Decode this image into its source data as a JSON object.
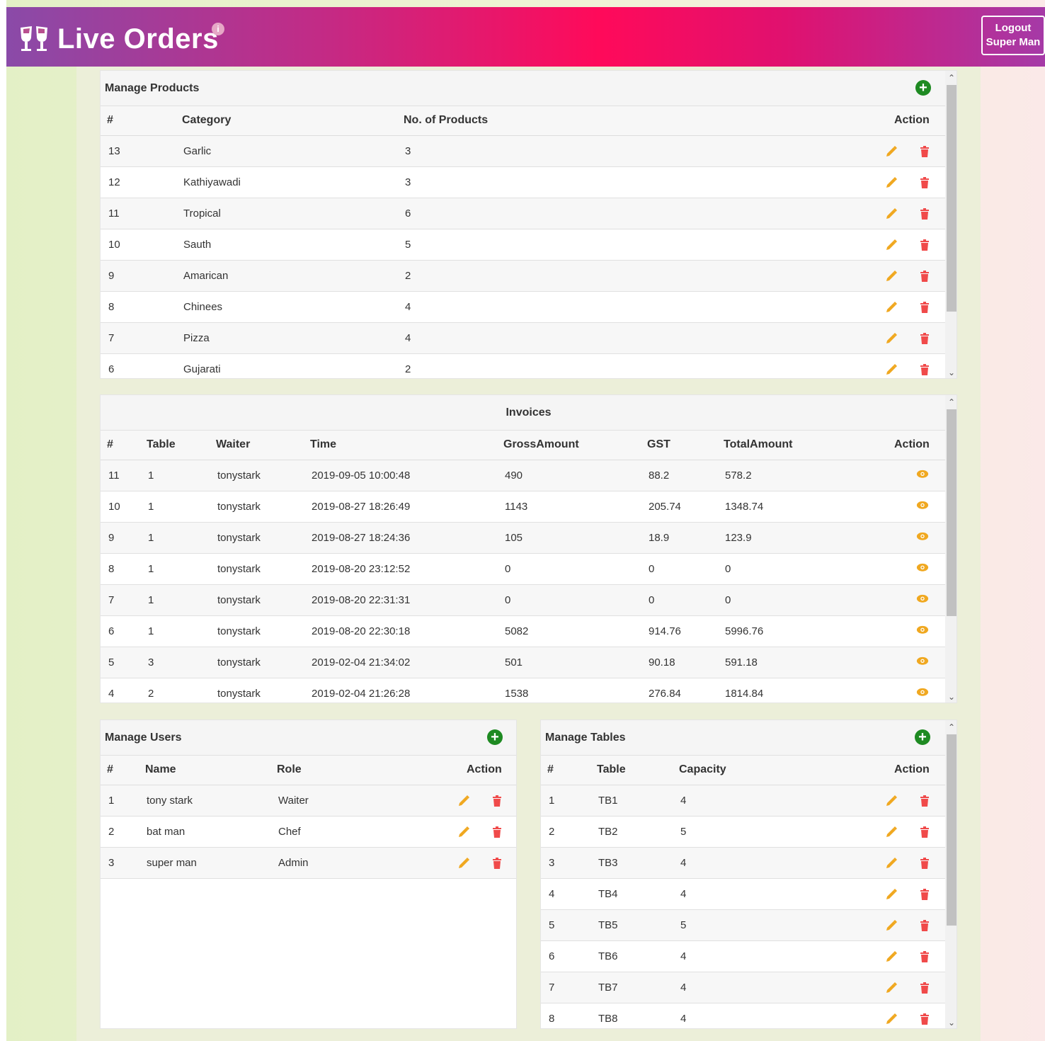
{
  "header": {
    "title": "Live Orders",
    "info_glyph": "i",
    "logout_label": "Logout",
    "user_name": "Super Man"
  },
  "products": {
    "title": "Manage Products",
    "columns": [
      "#",
      "Category",
      "No. of Products",
      "Action"
    ],
    "rows": [
      [
        "13",
        "Garlic",
        "3"
      ],
      [
        "12",
        "Kathiyawadi",
        "3"
      ],
      [
        "11",
        "Tropical",
        "6"
      ],
      [
        "10",
        "Sauth",
        "5"
      ],
      [
        "9",
        "Amarican",
        "2"
      ],
      [
        "8",
        "Chinees",
        "4"
      ],
      [
        "7",
        "Pizza",
        "4"
      ],
      [
        "6",
        "Gujarati",
        "2"
      ]
    ]
  },
  "invoices": {
    "title": "Invoices",
    "columns": [
      "#",
      "Table",
      "Waiter",
      "Time",
      "GrossAmount",
      "GST",
      "TotalAmount",
      "Action"
    ],
    "rows": [
      [
        "11",
        "1",
        "tonystark",
        "2019-09-05 10:00:48",
        "490",
        "88.2",
        "578.2"
      ],
      [
        "10",
        "1",
        "tonystark",
        "2019-08-27 18:26:49",
        "1143",
        "205.74",
        "1348.74"
      ],
      [
        "9",
        "1",
        "tonystark",
        "2019-08-27 18:24:36",
        "105",
        "18.9",
        "123.9"
      ],
      [
        "8",
        "1",
        "tonystark",
        "2019-08-20 23:12:52",
        "0",
        "0",
        "0"
      ],
      [
        "7",
        "1",
        "tonystark",
        "2019-08-20 22:31:31",
        "0",
        "0",
        "0"
      ],
      [
        "6",
        "1",
        "tonystark",
        "2019-08-20 22:30:18",
        "5082",
        "914.76",
        "5996.76"
      ],
      [
        "5",
        "3",
        "tonystark",
        "2019-02-04 21:34:02",
        "501",
        "90.18",
        "591.18"
      ],
      [
        "4",
        "2",
        "tonystark",
        "2019-02-04 21:26:28",
        "1538",
        "276.84",
        "1814.84"
      ]
    ]
  },
  "users": {
    "title": "Manage Users",
    "columns": [
      "#",
      "Name",
      "Role",
      "Action"
    ],
    "rows": [
      [
        "1",
        "tony stark",
        "Waiter"
      ],
      [
        "2",
        "bat man",
        "Chef"
      ],
      [
        "3",
        "super man",
        "Admin"
      ]
    ]
  },
  "tables": {
    "title": "Manage Tables",
    "columns": [
      "#",
      "Table",
      "Capacity",
      "Action"
    ],
    "rows": [
      [
        "1",
        "TB1",
        "4"
      ],
      [
        "2",
        "TB2",
        "5"
      ],
      [
        "3",
        "TB3",
        "4"
      ],
      [
        "4",
        "TB4",
        "4"
      ],
      [
        "5",
        "TB5",
        "5"
      ],
      [
        "6",
        "TB6",
        "4"
      ],
      [
        "7",
        "TB7",
        "4"
      ],
      [
        "8",
        "TB8",
        "4"
      ]
    ]
  },
  "icons": {
    "add": "plus-circle-icon",
    "edit": "pencil-icon",
    "delete": "trash-icon",
    "view": "eye-icon"
  },
  "colors": {
    "add": "#1e8a22",
    "edit": "#f0a820",
    "delete": "#f04a4a"
  }
}
